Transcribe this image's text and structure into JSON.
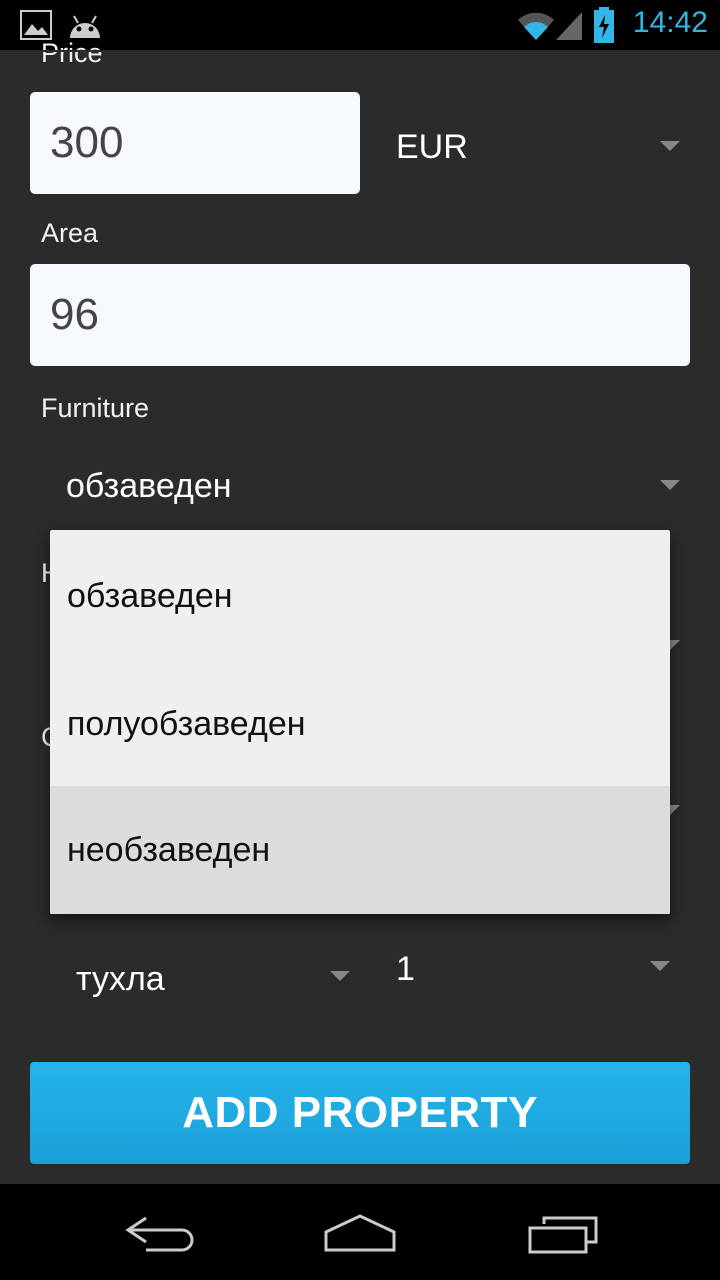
{
  "status_bar": {
    "time": "14:42"
  },
  "form": {
    "price_label": "Price",
    "price_value": "300",
    "currency": "EUR",
    "area_label": "Area",
    "area_value": "96",
    "furniture_label": "Furniture",
    "furniture_value": "обзаведен",
    "hidden_label_1": "Н",
    "hidden_label_2": "С",
    "building_type_value": "тухла",
    "floor_value": "1"
  },
  "dropdown": {
    "options": [
      "обзаведен",
      "полуобзаведен",
      "необзаведен"
    ],
    "highlighted_index": 2
  },
  "button": {
    "label": "ADD PROPERTY"
  },
  "colors": {
    "accent": "#33b5e5",
    "button": "#1fa9e1",
    "background": "#2b2b2b"
  }
}
